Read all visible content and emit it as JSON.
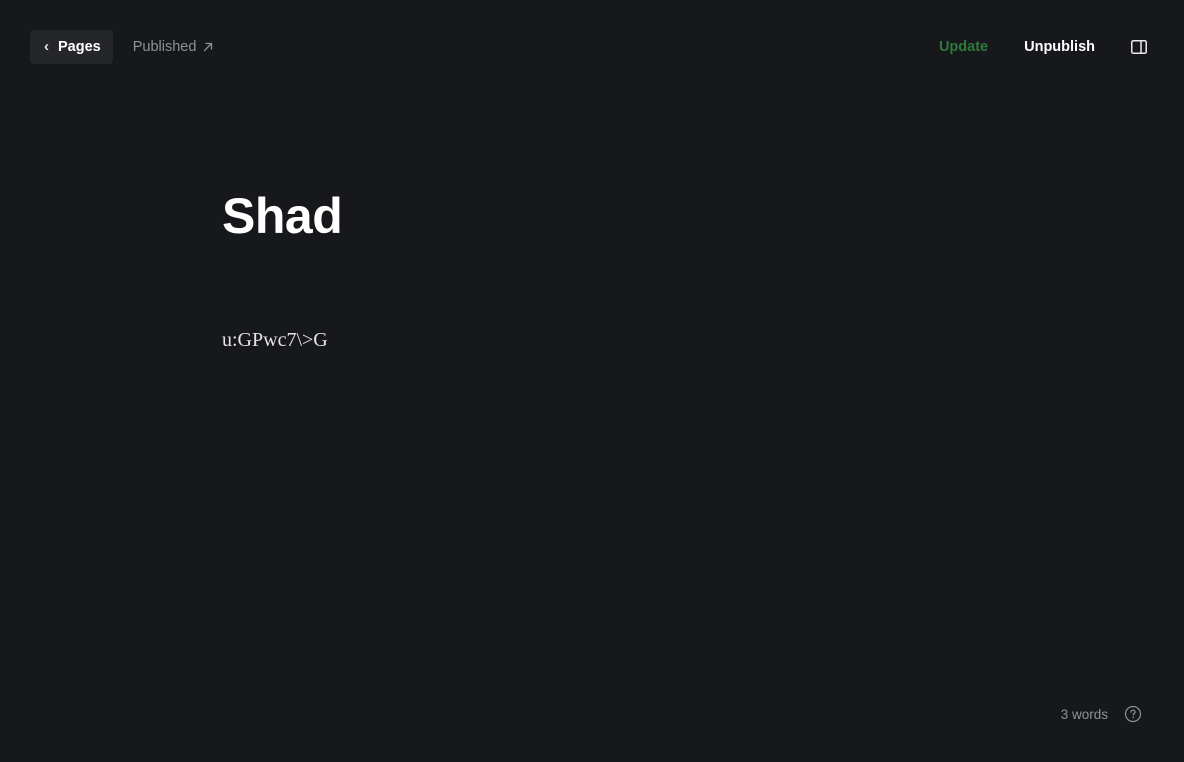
{
  "topbar": {
    "back_label": "Pages",
    "back_icon": "chevron-left-icon",
    "status_label": "Published",
    "status_icon": "arrow-up-right-icon",
    "update_label": "Update",
    "unpublish_label": "Unpublish",
    "sidebar_icon": "sidebar-toggle-icon"
  },
  "content": {
    "title": "Shad",
    "body": "u:GPwc7\\>G"
  },
  "footer": {
    "word_count": "3 words",
    "help_icon": "question-circle-icon"
  },
  "colors": {
    "background": "#17181b",
    "back_button_bg": "#25262a",
    "update_accent": "#2e7a3b",
    "muted_text": "#8e9197"
  }
}
